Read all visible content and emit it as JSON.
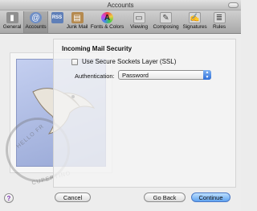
{
  "window": {
    "title": "Accounts"
  },
  "toolbar": {
    "items": [
      {
        "label": "General",
        "icon": "switch-icon",
        "selected": false
      },
      {
        "label": "Accounts",
        "icon": "at-sign-icon",
        "selected": true
      },
      {
        "label": "RSS",
        "icon": "rss-icon",
        "selected": false
      },
      {
        "label": "Junk Mail",
        "icon": "junk-mail-icon",
        "selected": false
      },
      {
        "label": "Fonts & Colors",
        "icon": "fonts-colors-icon",
        "selected": false
      },
      {
        "label": "Viewing",
        "icon": "viewing-icon",
        "selected": false
      },
      {
        "label": "Composing",
        "icon": "composing-icon",
        "selected": false
      },
      {
        "label": "Signatures",
        "icon": "signature-icon",
        "selected": false
      },
      {
        "label": "Rules",
        "icon": "rules-icon",
        "selected": false
      }
    ]
  },
  "stamp": {
    "postmark_top": "HELLO FR",
    "postmark_bottom": "CUPERTINO"
  },
  "incoming": {
    "section_title": "Incoming Mail Security",
    "ssl_label": "Use Secure Sockets Layer (SSL)",
    "ssl_checked": false,
    "auth_label": "Authentication:",
    "auth_value": "Password"
  },
  "footer": {
    "help": "?",
    "cancel": "Cancel",
    "go_back": "Go Back",
    "continue": "Continue"
  },
  "colors": {
    "accent": "#5fa2ef",
    "help": "#7a2fb0"
  }
}
